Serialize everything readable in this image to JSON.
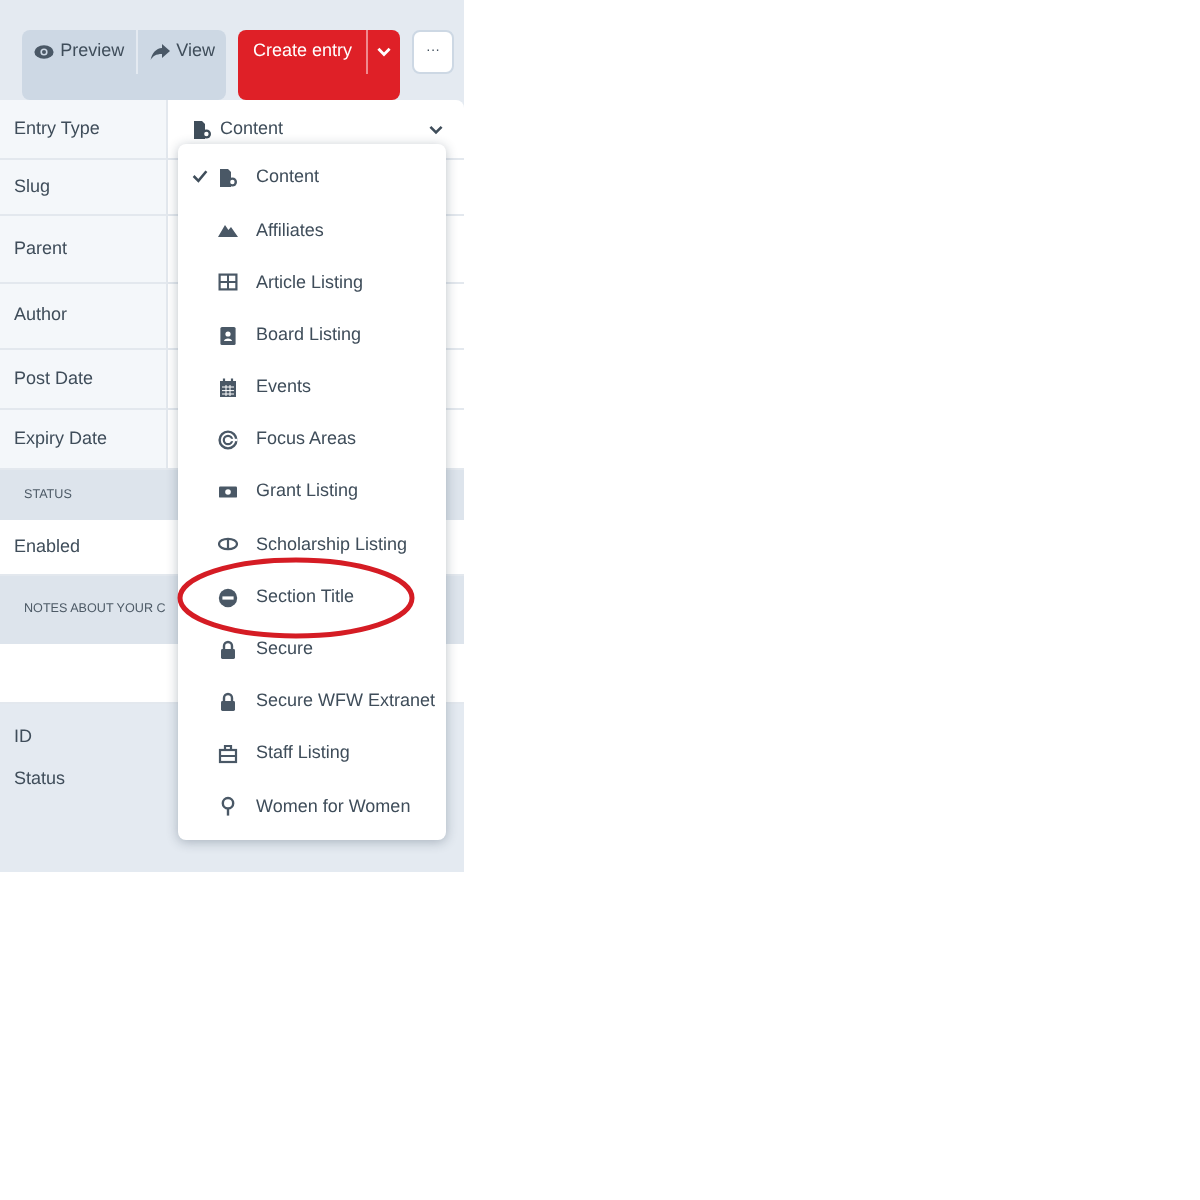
{
  "toolbar": {
    "buttons": [
      {
        "label": "Preview",
        "kind": "eye"
      },
      {
        "label": "View",
        "kind": "share"
      }
    ],
    "primary": {
      "label": "Create entry"
    },
    "more": {
      "label": "···"
    }
  },
  "fields": [
    {
      "label": "Entry Type",
      "value": "Content"
    },
    {
      "label": "Slug"
    },
    {
      "label": "Parent"
    },
    {
      "label": "Author"
    },
    {
      "label": "Post Date"
    },
    {
      "label": "Expiry Date"
    }
  ],
  "status_section": {
    "heading": "STATUS",
    "rows": [
      {
        "label": "Enabled"
      }
    ]
  },
  "notes_section": {
    "heading": "NOTES ABOUT YOUR C"
  },
  "meta": [
    {
      "label": "ID"
    },
    {
      "label": "Status"
    }
  ],
  "dropdown": {
    "items": [
      {
        "label": "Content",
        "selected": true,
        "circled": false
      },
      {
        "label": "Affiliates",
        "selected": false,
        "circled": false
      },
      {
        "label": "Article Listing",
        "selected": false,
        "circled": false
      },
      {
        "label": "Board Listing",
        "selected": false,
        "circled": false
      },
      {
        "label": "Events",
        "selected": false,
        "circled": false
      },
      {
        "label": "Focus Areas",
        "selected": false,
        "circled": false
      },
      {
        "label": "Grant Listing",
        "selected": false,
        "circled": false
      },
      {
        "label": "Scholarship Listing",
        "selected": false,
        "circled": false
      },
      {
        "label": "Section Title",
        "selected": false,
        "circled": true
      },
      {
        "label": "Secure",
        "selected": false,
        "circled": false
      },
      {
        "label": "Secure WFW Extranet",
        "selected": false,
        "circled": false
      },
      {
        "label": "Staff Listing",
        "selected": false,
        "circled": false
      },
      {
        "label": "Women for Women",
        "selected": false,
        "circled": false
      }
    ]
  }
}
